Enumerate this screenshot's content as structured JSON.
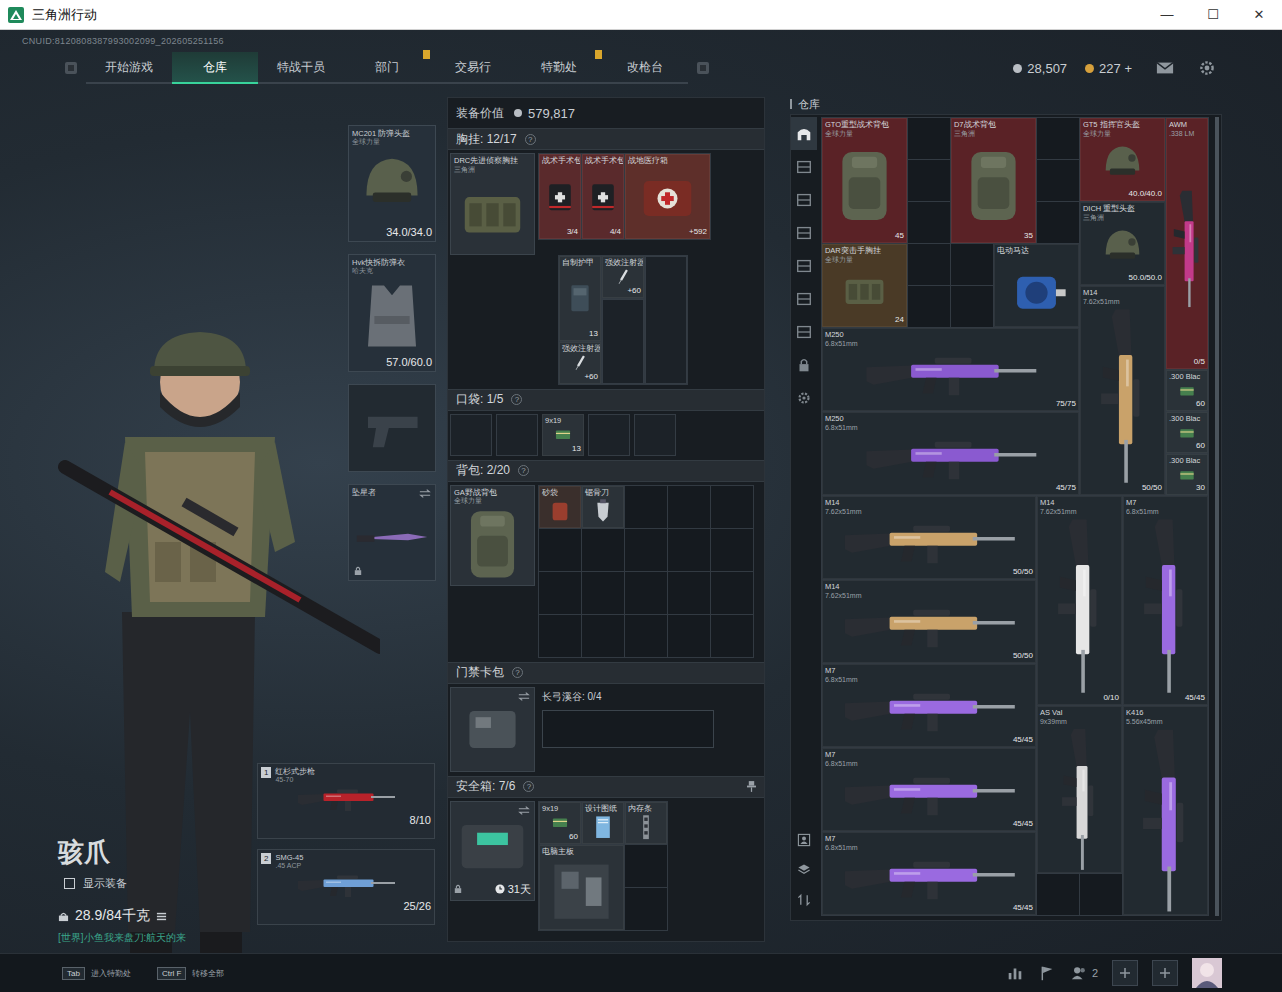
{
  "window": {
    "title": "三角洲行动",
    "controls": [
      "—",
      "☐",
      "✕"
    ]
  },
  "uid": "CNUID:8120808387993002099_202605251156",
  "nav": {
    "tabs": [
      {
        "label": "开始游戏",
        "selected": false,
        "badge": false
      },
      {
        "label": "仓库",
        "selected": true,
        "badge": false
      },
      {
        "label": "特战干员",
        "selected": false,
        "badge": false
      },
      {
        "label": "部门",
        "selected": false,
        "badge": true
      },
      {
        "label": "交易行",
        "selected": false,
        "badge": false
      },
      {
        "label": "特勤处",
        "selected": false,
        "badge": true
      },
      {
        "label": "改枪台",
        "selected": false,
        "badge": false
      }
    ]
  },
  "currency": [
    {
      "value": "28,507",
      "color": "#b9bec4"
    },
    {
      "value": "227 +",
      "color": "#d6a03c"
    }
  ],
  "character": {
    "name": "骇爪",
    "show_equipment": {
      "label": "显示装备",
      "checked": false
    },
    "weight": "28.9/84千克",
    "chat": "[世界]小鱼我来盘刀:航天的来"
  },
  "gear": [
    {
      "kind": "helmet",
      "name": "MC201 防弹头盔",
      "brand": "全球力量",
      "reading": "34.0/34.0",
      "locked": false
    },
    {
      "kind": "armor",
      "name": "Hvk快拆防弹衣",
      "brand": "哈夫克",
      "reading": "57.0/60.0",
      "locked": false
    },
    {
      "kind": "pistol",
      "locked": false
    },
    {
      "kind": "knife",
      "name": "坠星者",
      "locked": true
    }
  ],
  "weapons": [
    {
      "index": "1",
      "name": "红杉式步枪",
      "ammo": "45-70",
      "count": "8/10",
      "accent": "#b8222a"
    },
    {
      "index": "2",
      "name": "SMG-45",
      "ammo": ".45 ACP",
      "count": "25/26",
      "accent": "#6f9fd6"
    }
  ],
  "loadout": {
    "value_label": "装备价值",
    "value": "579,817",
    "chest": {
      "title": "胸挂: 12/17",
      "help": "?",
      "rig": {
        "name": "DRC先进侦察胸挂",
        "brand": "三角洲"
      },
      "items": [
        {
          "kind": "medbag",
          "name": "战术手术包",
          "count": "3/4",
          "color": "#5a2a2c"
        },
        {
          "kind": "medbag",
          "name": "战术手术包",
          "count": "4/4",
          "color": "#5a2a2c"
        },
        {
          "kind": "medkit",
          "name": "战地医疗箱",
          "count": "+592",
          "color": "#5e2f2a"
        },
        {
          "kind": "plate",
          "name": "自制护甲",
          "count": "13",
          "color": "#2b3238"
        },
        {
          "kind": "syringe",
          "name": "强效注射器",
          "count": "+60",
          "color": "#2b3238"
        },
        {
          "kind": "syringe",
          "name": "强效注射器",
          "count": "+60",
          "color": "#2b3238"
        },
        {
          "kind": "empty"
        },
        {
          "kind": "empty"
        }
      ]
    },
    "pockets": {
      "title": "口袋: 1/5",
      "help": "?",
      "slots": [
        {
          "kind": "empty"
        },
        {
          "kind": "empty"
        },
        {
          "kind": "ammo",
          "name": "9x19",
          "count": "13",
          "color": "#2b3238"
        },
        {
          "kind": "empty"
        },
        {
          "kind": "empty"
        }
      ]
    },
    "backpack": {
      "title": "背包: 2/20",
      "help": "?",
      "bag": {
        "name": "GA野战背包",
        "brand": "全球力量"
      },
      "items": [
        {
          "kind": "sand",
          "name": "砂袋",
          "color": "#3a2f2c"
        },
        {
          "kind": "saw",
          "name": "锯骨刀",
          "color": "#2b3238"
        }
      ]
    },
    "keycard": {
      "title": "门禁卡包",
      "help": "?",
      "map": "长弓溪谷: 0/4"
    },
    "safebox": {
      "title": "安全箱: 7/6",
      "help": "?",
      "time": "31天",
      "locked": true,
      "items": [
        {
          "kind": "ammo",
          "name": "9x19",
          "count": "60",
          "color": "#2b3238"
        },
        {
          "kind": "paper",
          "name": "设计图纸",
          "color": "#2b3238"
        },
        {
          "kind": "ram",
          "name": "内存条",
          "color": "#2b3238"
        },
        {
          "kind": "board",
          "name": "电脑主板",
          "color": "#2b3238"
        }
      ]
    }
  },
  "warehouse": {
    "title": "仓库",
    "tabs": [
      {
        "kind": "home",
        "selected": true
      },
      {
        "kind": "shelf",
        "selected": false
      },
      {
        "kind": "shelf",
        "selected": false
      },
      {
        "kind": "shelf",
        "selected": false
      },
      {
        "kind": "shelf",
        "selected": false
      },
      {
        "kind": "shelf",
        "selected": false
      },
      {
        "kind": "shelf",
        "selected": false
      },
      {
        "kind": "lock",
        "selected": false
      },
      {
        "kind": "gear",
        "selected": false
      }
    ],
    "tools": [
      {
        "kind": "person"
      },
      {
        "kind": "layers"
      },
      {
        "kind": "sort"
      }
    ],
    "items": [
      {
        "kind": "backpack",
        "name": "GTO重型战术背包",
        "brand": "全球力量",
        "count": "45",
        "color": "#5a2226"
      },
      {
        "kind": "backpack",
        "name": "D7战术背包",
        "brand": "三角洲",
        "count": "35",
        "color": "#5a2226"
      },
      {
        "kind": "helmet",
        "name": "GT5 指挥官头盔",
        "brand": "全球力量",
        "count": "40.0/40.0",
        "color": "#5a2226"
      },
      {
        "kind": "gun",
        "name": "AWM",
        "brand": ".338 LM",
        "count": "0/5",
        "color": "#5a2226",
        "accent": "#c23a8a"
      },
      {
        "kind": "helmet",
        "name": "DICH 重型头盔",
        "brand": "三角洲",
        "count": "50.0/50.0",
        "color": "#222a30"
      },
      {
        "kind": "rig",
        "name": "DAR突击手胸挂",
        "brand": "全球力量",
        "count": "24",
        "color": "#4a3a26"
      },
      {
        "kind": "motor",
        "name": "电动马达",
        "color": "#222a30"
      },
      {
        "kind": "gun",
        "name": "M14",
        "brand": "7.62x51mm",
        "count": "50/50",
        "color": "#222a30",
        "accent": "#c9a26a"
      },
      {
        "kind": "gun",
        "name": "M250",
        "brand": "6.8x51mm",
        "count": "75/75",
        "color": "#222a30",
        "accent": "#8a5ad0"
      },
      {
        "kind": "gun",
        "name": "M250",
        "brand": "6.8x51mm",
        "count": "45/75",
        "color": "#222a30",
        "accent": "#8a5ad0"
      },
      {
        "kind": "ammo",
        "name": ".300 Blac",
        "count": "60",
        "color": "#2a3238"
      },
      {
        "kind": "ammo",
        "name": ".300 Blac",
        "count": "60",
        "color": "#2a3238"
      },
      {
        "kind": "ammo",
        "name": ".300 Blac",
        "count": "30",
        "color": "#2a3238"
      },
      {
        "kind": "gun",
        "name": "M14",
        "brand": "7.62x51mm",
        "count": "50/50",
        "color": "#222a30",
        "accent": "#c9a26a"
      },
      {
        "kind": "gun",
        "name": "M14",
        "brand": "7.62x51mm",
        "count": "50/50",
        "color": "#222a30",
        "accent": "#c9a26a"
      },
      {
        "kind": "gun",
        "name": "M14",
        "brand": "7.62x51mm",
        "count": "0/10",
        "color": "#222a30",
        "accent": "#e6e6e6"
      },
      {
        "kind": "gun",
        "name": "M7",
        "brand": "6.8x51mm",
        "count": "45/45",
        "color": "#222a30",
        "accent": "#9a6ae0"
      },
      {
        "kind": "gun",
        "name": "M7",
        "brand": "6.8x51mm",
        "count": "45/45",
        "color": "#222a30",
        "accent": "#9a6ae0"
      },
      {
        "kind": "gun",
        "name": "AS Val",
        "brand": "9x39mm",
        "color": "#222a30",
        "accent": "#d8d8d8"
      },
      {
        "kind": "gun",
        "name": "K416",
        "brand": "5.56x45mm",
        "color": "#222a30",
        "accent": "#9a6ae0"
      },
      {
        "kind": "gun",
        "name": "M7",
        "brand": "6.8x51mm",
        "count": "45/45",
        "color": "#222a30",
        "accent": "#9a6ae0"
      },
      {
        "kind": "gun",
        "name": "M7",
        "brand": "6.8x51mm",
        "count": "45/45",
        "color": "#222a30",
        "accent": "#9a6ae0"
      }
    ]
  },
  "hotkeys": [
    {
      "key": "Tab",
      "label": "进入特勤处"
    },
    {
      "key": "Ctrl F",
      "label": "转移全部"
    }
  ],
  "social": {
    "friends": "2"
  }
}
